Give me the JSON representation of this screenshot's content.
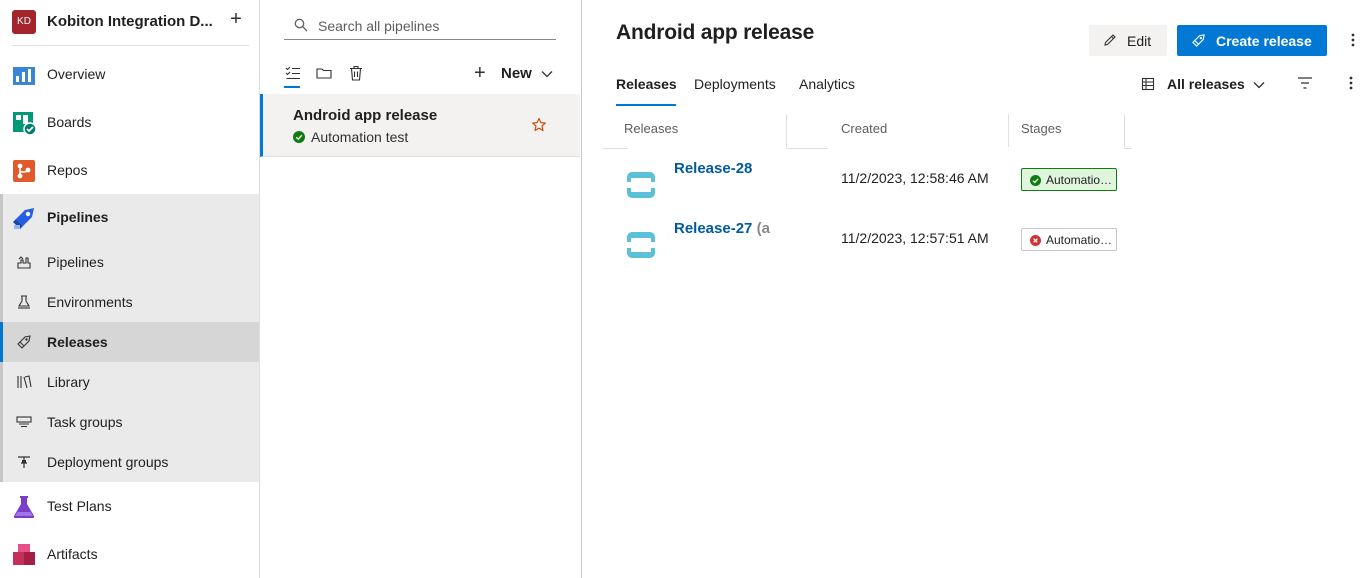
{
  "org": {
    "initials": "KD",
    "name": "Kobiton Integration D...",
    "avatar_color": "#a4262c"
  },
  "nav": {
    "items": [
      {
        "label": "Overview",
        "icon": "overview-icon"
      },
      {
        "label": "Boards",
        "icon": "boards-icon"
      },
      {
        "label": "Repos",
        "icon": "repos-icon"
      },
      {
        "label": "Pipelines",
        "icon": "pipelines-icon"
      },
      {
        "label": "Test Plans",
        "icon": "test-plans-icon"
      },
      {
        "label": "Artifacts",
        "icon": "artifacts-icon"
      }
    ],
    "pipelines_sub": [
      {
        "label": "Pipelines",
        "icon": "pipeline-sub-icon"
      },
      {
        "label": "Environments",
        "icon": "environments-icon"
      },
      {
        "label": "Releases",
        "icon": "releases-icon",
        "selected": true
      },
      {
        "label": "Library",
        "icon": "library-icon"
      },
      {
        "label": "Task groups",
        "icon": "task-groups-icon"
      },
      {
        "label": "Deployment groups",
        "icon": "deployment-groups-icon"
      }
    ]
  },
  "pipelines_pane": {
    "search_placeholder": "Search all pipelines",
    "new_label": "New",
    "items": [
      {
        "title": "Android app release",
        "subtitle": "Automation test",
        "status": "succeeded"
      }
    ]
  },
  "main": {
    "title": "Android app release",
    "edit_label": "Edit",
    "create_label": "Create release",
    "tabs": [
      "Releases",
      "Deployments",
      "Analytics"
    ],
    "view_label": "All releases",
    "columns": [
      "Releases",
      "Created",
      "Stages"
    ],
    "rows": [
      {
        "name": "Release-28",
        "extra": "",
        "created": "11/2/2023, 12:58:46 AM",
        "stage": "Automation test",
        "stage_status": "succeeded"
      },
      {
        "name": "Release-27",
        "extra": "(a",
        "created": "11/2/2023, 12:57:51 AM",
        "stage": "Automation test",
        "stage_status": "failed"
      }
    ]
  },
  "colors": {
    "accent": "#0078d4",
    "link": "#005a9e",
    "success": "#107c10",
    "error": "#d13438"
  }
}
